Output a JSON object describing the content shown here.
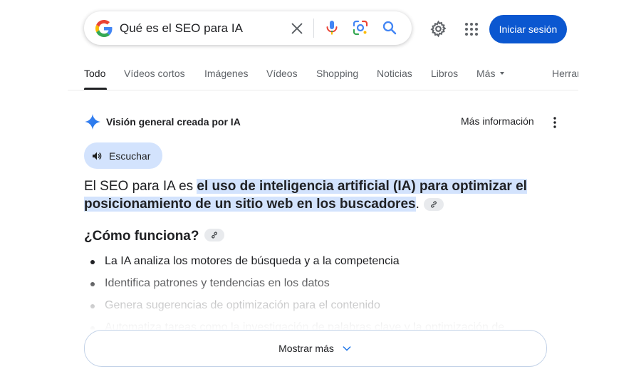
{
  "search": {
    "query": "Qué es el SEO para IA"
  },
  "header": {
    "signin_label": "Iniciar sesión"
  },
  "tabs": [
    {
      "label": "Todo",
      "active": true
    },
    {
      "label": "Vídeos cortos"
    },
    {
      "label": "Imágenes"
    },
    {
      "label": "Vídeos"
    },
    {
      "label": "Shopping"
    },
    {
      "label": "Noticias"
    },
    {
      "label": "Libros"
    },
    {
      "label": "Más"
    },
    {
      "label": "Herramientas"
    }
  ],
  "ai_overview": {
    "title": "Visión general creada por IA",
    "more_info": "Más información",
    "listen_label": "Escuchar",
    "answer_prefix": "El SEO para IA es ",
    "answer_highlight": "el uso de inteligencia artificial (IA) para optimizar el posicionamiento de un sitio web en los buscadores",
    "answer_suffix": ".",
    "how_heading": "¿Cómo funciona?",
    "bullets": [
      "La IA analiza los motores de búsqueda y a la competencia",
      "Identifica patrones y tendencias en los datos",
      "Genera sugerencias de optimización para el contenido",
      "Automatiza tareas como la investigación de palabras clave y la optimización de"
    ],
    "show_more_label": "Mostrar más"
  },
  "colors": {
    "accent": "#0b57d0",
    "highlight": "#d3e3fd"
  },
  "icons": [
    "google-g-icon",
    "clear-icon",
    "mic-icon",
    "lens-icon",
    "search-icon",
    "gear-icon",
    "apps-grid-icon",
    "sparkle-icon",
    "kebab-menu-icon",
    "speaker-icon",
    "link-icon",
    "chevron-down-icon"
  ]
}
